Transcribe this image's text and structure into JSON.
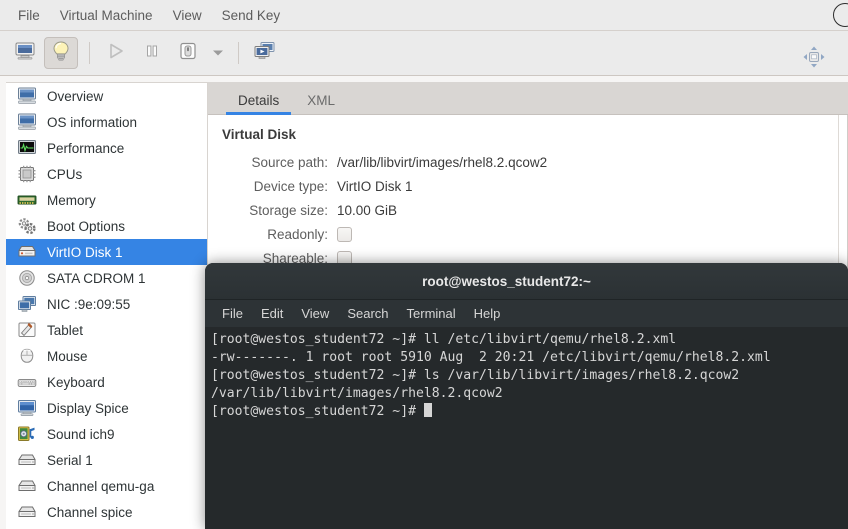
{
  "vmm": {
    "menubar": {
      "items": [
        {
          "label": "File",
          "name": "menu-file"
        },
        {
          "label": "Virtual Machine",
          "name": "menu-virtual-machine"
        },
        {
          "label": "View",
          "name": "menu-view"
        },
        {
          "label": "Send Key",
          "name": "menu-send-key"
        }
      ]
    },
    "toolbar": {
      "buttons": [
        {
          "icon": "console-monitor-icon",
          "name": "show-console-button",
          "pressed": false
        },
        {
          "icon": "lightbulb-details-icon",
          "name": "show-details-button",
          "pressed": true
        },
        {
          "icon": "play-run-icon",
          "name": "run-button",
          "pressed": false,
          "disabled": true
        },
        {
          "icon": "pause-icon",
          "name": "pause-button",
          "pressed": false
        },
        {
          "icon": "power-shutdown-icon",
          "name": "shutdown-button",
          "pressed": false
        },
        {
          "icon": "chevron-down-icon",
          "name": "shutdown-options-caret",
          "pressed": false
        },
        {
          "icon": "snapshots-icon",
          "name": "snapshots-button",
          "pressed": false
        }
      ],
      "fullscreen_icon": "fullscreen-arrows-icon"
    },
    "sidebar": {
      "items": [
        {
          "label": "Overview",
          "icon": "computer-icon",
          "selected": false
        },
        {
          "label": "OS information",
          "icon": "computer-icon",
          "selected": false
        },
        {
          "label": "Performance",
          "icon": "performance-graph-icon",
          "selected": false
        },
        {
          "label": "CPUs",
          "icon": "cpu-chip-icon",
          "selected": false
        },
        {
          "label": "Memory",
          "icon": "memory-ram-icon",
          "selected": false
        },
        {
          "label": "Boot Options",
          "icon": "gears-icon",
          "selected": false
        },
        {
          "label": "VirtIO Disk 1",
          "icon": "harddisk-icon",
          "selected": true
        },
        {
          "label": "SATA CDROM 1",
          "icon": "cdrom-disc-icon",
          "selected": false
        },
        {
          "label": "NIC :9e:09:55",
          "icon": "network-card-icon",
          "selected": false
        },
        {
          "label": "Tablet",
          "icon": "tablet-pen-icon",
          "selected": false
        },
        {
          "label": "Mouse",
          "icon": "mouse-icon",
          "selected": false
        },
        {
          "label": "Keyboard",
          "icon": "keyboard-icon",
          "selected": false
        },
        {
          "label": "Display Spice",
          "icon": "display-monitor-icon",
          "selected": false
        },
        {
          "label": "Sound ich9",
          "icon": "sound-speaker-icon",
          "selected": false
        },
        {
          "label": "Serial 1",
          "icon": "serial-port-icon",
          "selected": false
        },
        {
          "label": "Channel qemu-ga",
          "icon": "serial-port-icon",
          "selected": false
        },
        {
          "label": "Channel spice",
          "icon": "serial-port-icon",
          "selected": false
        }
      ]
    },
    "tabs": [
      {
        "label": "Details",
        "active": true
      },
      {
        "label": "XML",
        "active": false
      }
    ],
    "details": {
      "section_title": "Virtual Disk",
      "fields": [
        {
          "label": "Source path:",
          "value": "/var/lib/libvirt/images/rhel8.2.qcow2",
          "type": "text"
        },
        {
          "label": "Device type:",
          "value": "VirtIO Disk 1",
          "type": "text"
        },
        {
          "label": "Storage size:",
          "value": "10.00 GiB",
          "type": "text"
        },
        {
          "label": "Readonly:",
          "value": "",
          "type": "checkbox",
          "checked": false
        },
        {
          "label": "Shareable:",
          "value": "",
          "type": "checkbox",
          "checked": false
        }
      ]
    }
  },
  "terminal": {
    "title": "root@westos_student72:~",
    "menubar": [
      "File",
      "Edit",
      "View",
      "Search",
      "Terminal",
      "Help"
    ],
    "lines": [
      "[root@westos_student72 ~]# ll /etc/libvirt/qemu/rhel8.2.xml",
      "-rw-------. 1 root root 5910 Aug  2 20:21 /etc/libvirt/qemu/rhel8.2.xml",
      "[root@westos_student72 ~]# ls /var/lib/libvirt/images/rhel8.2.qcow2",
      "/var/lib/libvirt/images/rhel8.2.qcow2"
    ],
    "prompt": "[root@westos_student72 ~]# ",
    "cursor": "block"
  },
  "colors": {
    "accent_blue": "#3584e4",
    "sidebar_bg": "#ffffff",
    "toolbar_bg": "#ebebeb",
    "terminal_bg": "#25292b",
    "terminal_fg": "#d6d6d6",
    "tabbar_bg": "#d9d6d3"
  }
}
